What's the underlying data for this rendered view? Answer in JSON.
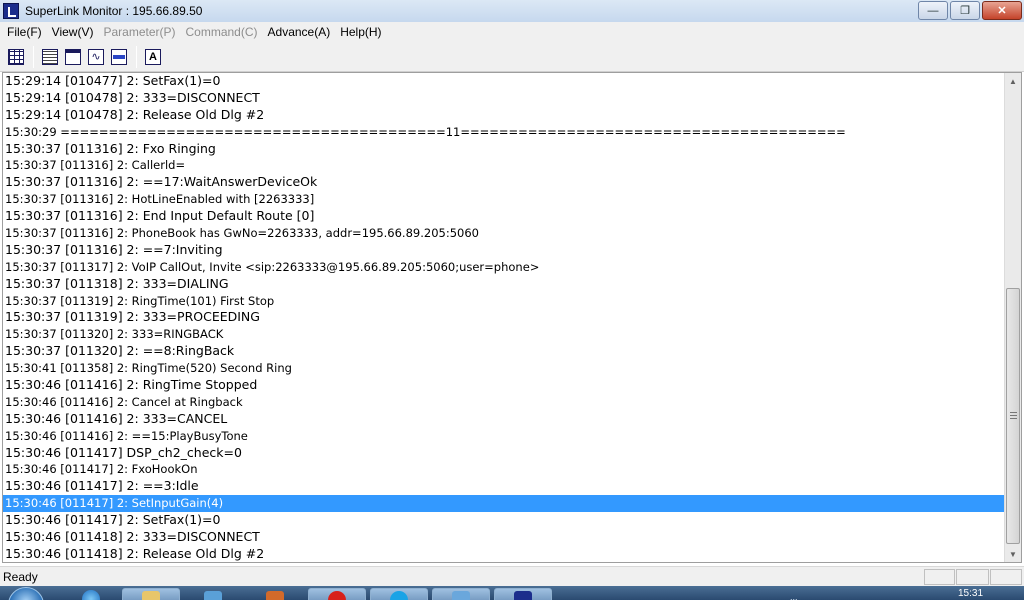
{
  "window": {
    "title": "SuperLink Monitor : 195.66.89.50",
    "buttons": {
      "minimize": "—",
      "maximize": "❐",
      "close": "✕"
    }
  },
  "menu": [
    {
      "label": "File(F)",
      "enabled": true
    },
    {
      "label": "View(V)",
      "enabled": true
    },
    {
      "label": "Parameter(P)",
      "enabled": false
    },
    {
      "label": "Command(C)",
      "enabled": false
    },
    {
      "label": "Advance(A)",
      "enabled": true
    },
    {
      "label": "Help(H)",
      "enabled": true
    }
  ],
  "toolbar": {
    "icons": [
      "grid-view-icon",
      "text-list-icon",
      "window-icon",
      "waveform-icon",
      "bar-icon",
      "font-icon"
    ],
    "font_letter": "A",
    "wave_glyph": "∿"
  },
  "log": {
    "lines": [
      {
        "text": "15:29:14 [010477] 2: SetFax(1)=0",
        "small": false
      },
      {
        "text": "15:29:14 [010478] 2: 333=DISCONNECT",
        "small": false
      },
      {
        "text": "15:29:14 [010478] 2: Release Old Dlg #2",
        "small": false
      },
      {
        "text": "15:30:29 ========================================11========================================",
        "small": true
      },
      {
        "text": "15:30:37 [011316] 2: Fxo Ringing",
        "small": false
      },
      {
        "text": "15:30:37 [011316] 2: Callerld=",
        "small": true
      },
      {
        "text": "15:30:37 [011316] 2: ==17:WaitAnswerDeviceOk",
        "small": false
      },
      {
        "text": "15:30:37 [011316] 2: HotLineEnabled with [2263333]",
        "small": true
      },
      {
        "text": "15:30:37 [011316] 2: End Input Default Route [0]",
        "small": false
      },
      {
        "text": "15:30:37 [011316] 2: PhoneBook has GwNo=2263333, addr=195.66.89.205:5060",
        "small": true
      },
      {
        "text": "15:30:37 [011316] 2: ==7:Inviting",
        "small": false
      },
      {
        "text": "15:30:37 [011317] 2: VoIP CallOut, Invite <sip:2263333@195.66.89.205:5060;user=phone>",
        "small": true
      },
      {
        "text": "15:30:37 [011318] 2: 333=DIALING",
        "small": false
      },
      {
        "text": "15:30:37 [011319] 2: RingTime(101) First Stop",
        "small": true
      },
      {
        "text": "15:30:37 [011319] 2: 333=PROCEEDING",
        "small": false
      },
      {
        "text": "15:30:37 [011320] 2: 333=RINGBACK",
        "small": true
      },
      {
        "text": "15:30:37 [011320] 2: ==8:RingBack",
        "small": false
      },
      {
        "text": "15:30:41 [011358] 2: RingTime(520) Second Ring",
        "small": true
      },
      {
        "text": "15:30:46 [011416] 2: RingTime Stopped",
        "small": false
      },
      {
        "text": "15:30:46 [011416] 2: Cancel at Ringback",
        "small": true
      },
      {
        "text": "15:30:46 [011416] 2: 333=CANCEL",
        "small": false
      },
      {
        "text": "15:30:46 [011416] 2: ==15:PlayBusyTone",
        "small": true
      },
      {
        "text": "15:30:46 [011417] DSP_ch2_check=0",
        "small": false
      },
      {
        "text": "15:30:46 [011417] 2: FxoHookOn",
        "small": true
      },
      {
        "text": "15:30:46 [011417] 2: ==3:Idle",
        "small": false
      },
      {
        "text": "15:30:46 [011417] 2: SetInputGain(4)",
        "small": true
      },
      {
        "text": "15:30:46 [011417] 2: SetFax(1)=0",
        "small": false
      },
      {
        "text": "15:30:46 [011418] 2: 333=DISCONNECT",
        "small": false
      },
      {
        "text": "15:30:46 [011418] 2: Release Old Dlg #2",
        "small": false
      }
    ],
    "selected_index": 25
  },
  "scrollbar": {
    "up": "▲",
    "down": "▼"
  },
  "status": {
    "text": "Ready"
  },
  "taskbar": {
    "clock": "15:31",
    "tray_text": "..."
  },
  "colors": {
    "selection": "#3399ff",
    "title_bar": "#c6d8ee"
  }
}
